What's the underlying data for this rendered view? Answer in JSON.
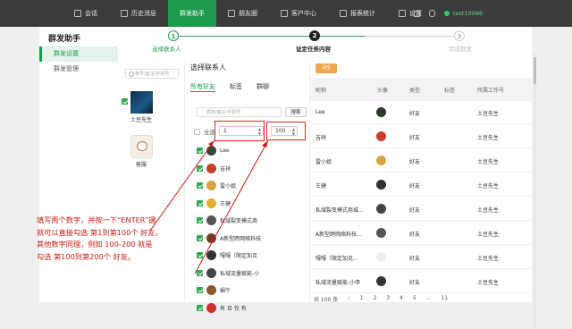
{
  "nav": {
    "items": [
      {
        "label": "会话"
      },
      {
        "label": "历史消息"
      },
      {
        "label": "群发助手"
      },
      {
        "label": "朋友圈"
      },
      {
        "label": "客户中心"
      },
      {
        "label": "报表统计"
      },
      {
        "label": "设置"
      }
    ],
    "user": "test10086"
  },
  "sidebar": {
    "title": "群发助手",
    "items": [
      {
        "label": "群发设置"
      },
      {
        "label": "群发管理"
      }
    ]
  },
  "steps": [
    {
      "num": "1",
      "label": "选择联系人"
    },
    {
      "num": "2",
      "label": "设定任务内容"
    },
    {
      "num": "3",
      "label": "完成群发"
    }
  ],
  "accounts": {
    "search_placeholder": "帐号/备注/手机号",
    "items": [
      {
        "label": "土豆先生"
      },
      {
        "label": "客服"
      }
    ]
  },
  "contacts": {
    "title": "选择联系人",
    "tabs": [
      "所有好友",
      "标签",
      "群聊"
    ],
    "search_placeholder": "昵称/备注/手机号",
    "search_button": "搜索",
    "select_all": "全选",
    "range_from": "1",
    "range_to": "100",
    "items": [
      {
        "label": "Lee"
      },
      {
        "label": "吉祥"
      },
      {
        "label": "雷小姐"
      },
      {
        "label": "王健"
      },
      {
        "label": "私域裂变模式商"
      },
      {
        "label": "A新型跨网络科技"
      },
      {
        "label": "嘎嘎（限定加克"
      },
      {
        "label": "私域流量赋能-小"
      },
      {
        "label": "蜗牛"
      },
      {
        "label": "有 且 仅 有"
      }
    ]
  },
  "table": {
    "button": "清空",
    "headers": [
      "昵称",
      "头像",
      "类型",
      "标签",
      "所属工作号"
    ],
    "rows": [
      [
        "Lee",
        "好友",
        "",
        "土豆先生"
      ],
      [
        "吉祥",
        "好友",
        "",
        "土豆先生"
      ],
      [
        "雷小姐",
        "好友",
        "",
        "土豆先生"
      ],
      [
        "王健",
        "好友",
        "",
        "土豆先生"
      ],
      [
        "私域裂变模式商城...",
        "好友",
        "",
        "土豆先生"
      ],
      [
        "A新型跨网络科技...",
        "好友",
        "",
        "土豆先生"
      ],
      [
        "嘎嘎（限定加克...",
        "好友",
        "",
        "土豆先生"
      ],
      [
        "私域流量赋能-小李",
        "好友",
        "",
        "土豆先生"
      ]
    ],
    "pager": [
      "共 100 条",
      "‹",
      "1",
      "2",
      "3",
      "4",
      "5",
      "...",
      "11"
    ]
  },
  "annotation": {
    "lines": [
      "填写两个数字，并按一下“ENTER”键",
      "就可以直接勾选 第1到第100个 好友。",
      "其他数字同理，例如 100-200 就是",
      "勾选 第100到第200个 好友。"
    ]
  },
  "colors": {
    "accent": "#1c9c4b",
    "topbar": "#3b3b3b",
    "annotation": "#cc1a12",
    "clear_button": "#f0a64a"
  }
}
